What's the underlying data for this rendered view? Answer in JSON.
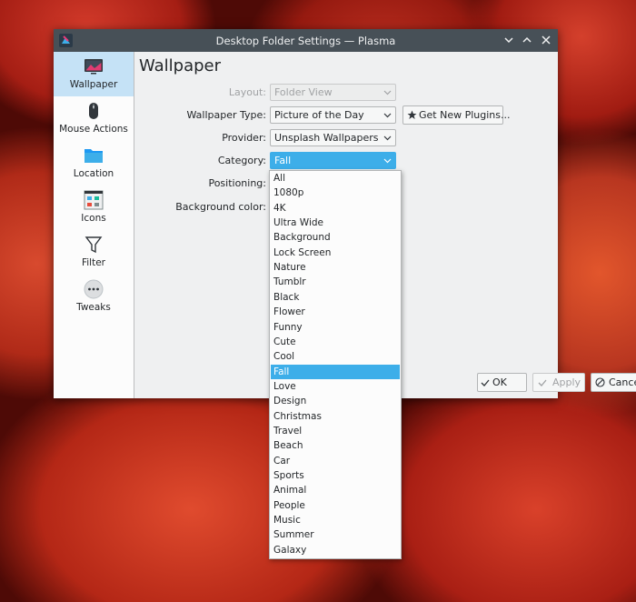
{
  "window": {
    "title": "Desktop Folder Settings — Plasma"
  },
  "sidebar": {
    "items": [
      {
        "label": "Wallpaper",
        "icon": "monitor-icon"
      },
      {
        "label": "Mouse Actions",
        "icon": "mouse-icon"
      },
      {
        "label": "Location",
        "icon": "folder-icon"
      },
      {
        "label": "Icons",
        "icon": "icons-view-icon"
      },
      {
        "label": "Filter",
        "icon": "filter-icon"
      },
      {
        "label": "Tweaks",
        "icon": "more-dots-icon"
      }
    ]
  },
  "page": {
    "title": "Wallpaper"
  },
  "form": {
    "layout_label": "Layout:",
    "layout_value": "Folder View",
    "type_label": "Wallpaper Type:",
    "type_value": "Picture of the Day",
    "get_plugins_label": "Get New Plugins...",
    "provider_label": "Provider:",
    "provider_value": "Unsplash Wallpapers",
    "category_label": "Category:",
    "category_value": "Fall",
    "positioning_label": "Positioning:",
    "bgcolor_label": "Background color:"
  },
  "buttons": {
    "ok": "OK",
    "apply": "Apply",
    "cancel": "Cancel"
  },
  "dropdown": {
    "selected_index": 13,
    "options": [
      "All",
      "1080p",
      "4K",
      "Ultra Wide",
      "Background",
      "Lock Screen",
      "Nature",
      "Tumblr",
      "Black",
      "Flower",
      "Funny",
      "Cute",
      "Cool",
      "Fall",
      "Love",
      "Design",
      "Christmas",
      "Travel",
      "Beach",
      "Car",
      "Sports",
      "Animal",
      "People",
      "Music",
      "Summer",
      "Galaxy"
    ]
  },
  "colors": {
    "accent": "#3daee9",
    "titlebar": "#475057",
    "selection": "#c5e2f6"
  }
}
